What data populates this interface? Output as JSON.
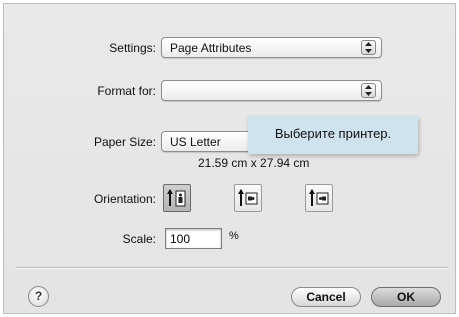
{
  "settings": {
    "label": "Settings:",
    "value": "Page Attributes"
  },
  "format_for": {
    "label": "Format for:",
    "value": ""
  },
  "tooltip": {
    "text": "Выберите принтер."
  },
  "paper_size": {
    "label": "Paper Size:",
    "value": "US Letter",
    "dimensions": "21.59 cm x 27.94 cm"
  },
  "orientation": {
    "label": "Orientation:",
    "options": [
      {
        "icon": "portrait-orientation-icon",
        "selected": true
      },
      {
        "icon": "landscape-orientation-icon",
        "selected": false
      },
      {
        "icon": "reverse-landscape-orientation-icon",
        "selected": false
      }
    ]
  },
  "scale": {
    "label": "Scale:",
    "value": "100",
    "unit": "%"
  },
  "buttons": {
    "help": "?",
    "cancel": "Cancel",
    "ok": "OK"
  }
}
